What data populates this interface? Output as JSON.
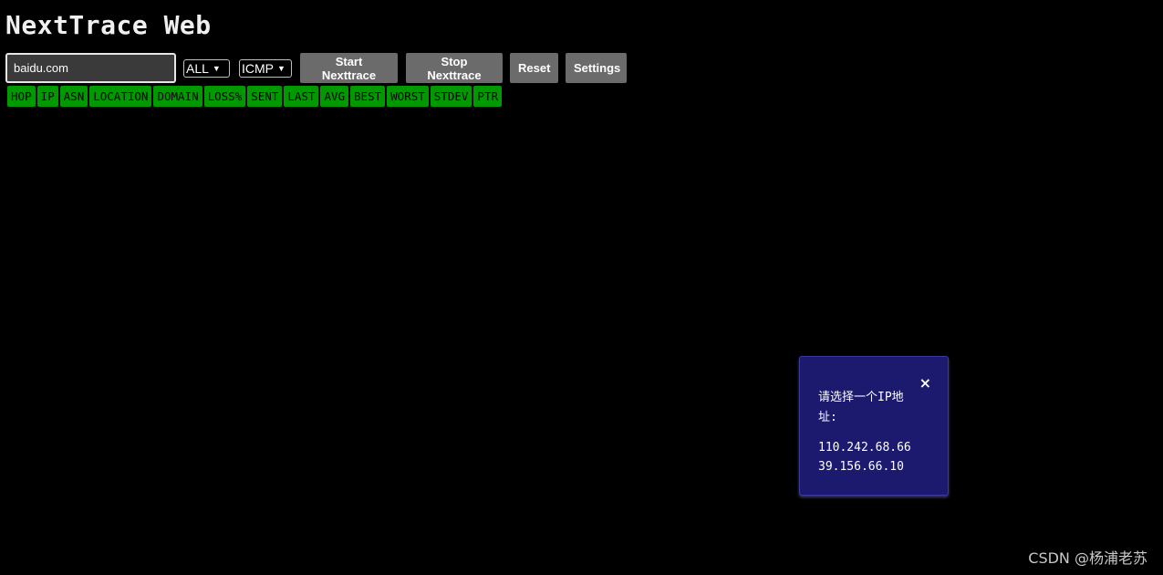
{
  "app": {
    "title": "NextTrace Web"
  },
  "controls": {
    "target_value": "baidu.com",
    "ip_version_selected": "ALL",
    "protocol_selected": "ICMP",
    "start_label": "Start Nexttrace",
    "stop_label": "Stop Nexttrace",
    "reset_label": "Reset",
    "settings_label": "Settings"
  },
  "table": {
    "columns": [
      "HOP",
      "IP",
      "ASN",
      "LOCATION",
      "DOMAIN",
      "LOSS%",
      "SENT",
      "LAST",
      "AVG",
      "BEST",
      "WORST",
      "STDEV",
      "PTR"
    ]
  },
  "popup": {
    "close_symbol": "×",
    "prompt": "请选择一个IP地址:",
    "ips": [
      "110.242.68.66",
      "39.156.66.10"
    ]
  },
  "watermark": "CSDN @杨浦老苏",
  "colors": {
    "background": "#000000",
    "header_green": "#009a00",
    "button_gray": "#6b6b6b",
    "popup_bg": "#1c1a6e"
  }
}
